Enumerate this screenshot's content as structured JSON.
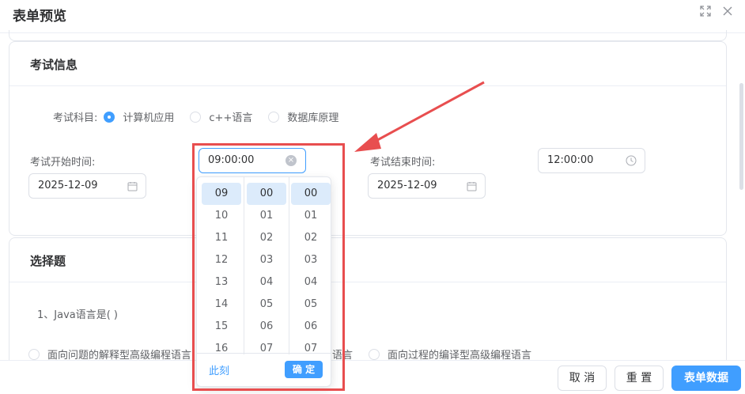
{
  "dialog": {
    "title": "表单预览",
    "fullscreen_icon": "fullscreen-icon",
    "close_icon": "close-icon"
  },
  "exam": {
    "section_title": "考试信息",
    "subject_label": "考试科目:",
    "subjects": [
      "计算机应用",
      "c++语言",
      "数据库原理"
    ],
    "selected_subject": "计算机应用",
    "start_label": "考试开始时间:",
    "start_date": "2025-12-09",
    "start_time": "09:00:00",
    "end_label": "考试结束时间:",
    "end_date": "2025-12-09",
    "end_time": "12:00:00"
  },
  "time_picker": {
    "hours": [
      "09",
      "10",
      "11",
      "12",
      "13",
      "14",
      "15",
      "16"
    ],
    "minutes": [
      "00",
      "01",
      "02",
      "03",
      "04",
      "05",
      "06",
      "07"
    ],
    "seconds": [
      "00",
      "01",
      "02",
      "03",
      "04",
      "05",
      "06",
      "07"
    ],
    "selected": {
      "hour": "09",
      "minute": "00",
      "second": "00"
    },
    "now_label": "此刻",
    "ok_label": "确 定"
  },
  "choice": {
    "section_title": "选择题",
    "question": "1、Java语言是( )",
    "options": [
      "面向问题的解释型高级编程语言",
      "语言",
      "面向过程的编译型高级编程语言"
    ]
  },
  "footer": {
    "cancel_label": "取 消",
    "reset_label": "重 置",
    "submit_label": "表单数据"
  },
  "colors": {
    "accent": "#409eff",
    "annotation": "#e84e4f"
  }
}
